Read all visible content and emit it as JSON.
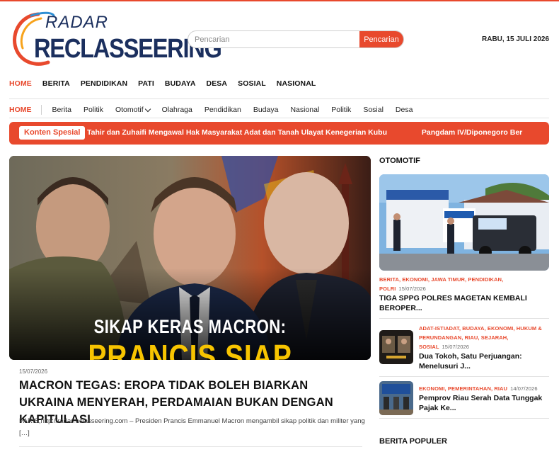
{
  "brand": {
    "line1": "RADAR",
    "line2": "RECLASSEERING"
  },
  "search": {
    "placeholder": "Pencarian",
    "button_label": "Pencarian"
  },
  "date": "RABU, 15 JULI 2026",
  "nav_primary": [
    "HOME",
    "BERITA",
    "PENDIDIKAN",
    "PATI",
    "BUDAYA",
    "DESA",
    "SOSIAL",
    "NASIONAL"
  ],
  "nav_secondary": [
    "HOME",
    "Berita",
    "Politik",
    "Otomotif",
    "Olahraga",
    "Pendidikan",
    "Budaya",
    "Nasional",
    "Politik",
    "Sosial",
    "Desa"
  ],
  "ticker": {
    "label": "Konten Spesial",
    "items": [
      "Tahir dan Zuhaifi Mengawal Hak Masyarakat Adat dan Tanah Ulayat Kenegerian Kubu",
      "Pangdam IV/Diponegoro Ber"
    ]
  },
  "hero": {
    "image_caption_1": "SIKAP KERAS MACRON:",
    "image_caption_2": "PRANCIS SIAP",
    "date": "15/07/2026",
    "title": "MACRON TEGAS: EROPA TIDAK BOLEH BIARKAN UKRAINA MENYERAH, PERDAMAIAN BUKAN DENGAN KAPITULASI",
    "excerpt": "PARIS,http://radarreclasseering.com – Presiden Prancis Emmanuel Macron mengambil sikap politik dan militer yang  […]"
  },
  "sidebar": {
    "heading": "OTOMOTIF",
    "featured": {
      "categories": "BERITA, EKONOMI, JAWA TIMUR, PENDIDIKAN, POLRI",
      "date": "15/07/2026",
      "title": "TIGA SPPG POLRES MAGETAN KEMBALI BEROPER..."
    },
    "items": [
      {
        "categories": "ADAT-ISTIADAT, BUDAYA, EKONOMI, HUKUM & PERUNDANGAN, RIAU, SEJARAH, SOSIAL",
        "date": "15/07/2026",
        "title": "Dua Tokoh, Satu Perjuangan: Menelusuri J..."
      },
      {
        "categories": "EKONOMI, PEMERINTAHAN, RIAU",
        "date": "14/07/2026",
        "title": "Pemprov Riau Serah Data Tunggak Pajak Ke..."
      }
    ],
    "heading2": "BERITA POPULER"
  },
  "colors": {
    "accent": "#e8492d",
    "brand_navy": "#1b2f5e"
  }
}
